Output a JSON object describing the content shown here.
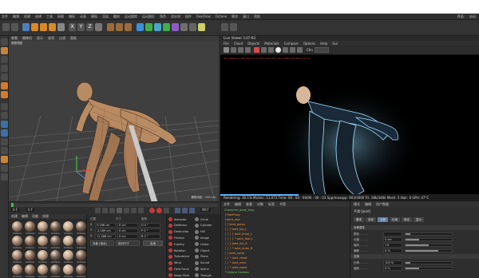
{
  "menubar": {
    "items": [
      "文件",
      "编辑",
      "创建",
      "选择",
      "工具",
      "网格",
      "捕捉",
      "动画",
      "模拟",
      "渲染",
      "雕刻",
      "运动跟踪",
      "运动图形",
      "角色",
      "流水线",
      "插件",
      "RealFlow",
      "Octane",
      "脚本",
      "窗口",
      "帮助"
    ],
    "right_items": [
      "界面:",
      "启动"
    ]
  },
  "viewport": {
    "menu": [
      "查看",
      "摄像机",
      "显示",
      "选项",
      "过滤",
      "面板"
    ],
    "title": "透视视图",
    "footer": "栅格间距 : 100 cm"
  },
  "live_viewer": {
    "title": "Live Viewer 3.07-R2",
    "menu": [
      "File",
      "Cloud",
      "Objects",
      "Materials",
      "Compare",
      "Options",
      "Help",
      "Gui"
    ],
    "channel": "Chn",
    "status": "Rendering: 30.1%   Ms/sec: 11.073   Time: 00 : 00 : 00/00 : 00 : 03   Spp/maxspp: 903/3000   Tri: 18k/346k   Mesh: 5   Hair: 0   GPU: 47°C",
    "progress": 0.301,
    "top_info": "Tone Mapping ON  Gamma 2.2  Denoiser  Film size 1280x720  Path tracing"
  },
  "timeline": {
    "start_frame": "0 F",
    "end_frame": "90 F",
    "current_frame": "0 F"
  },
  "materials": {
    "menu": [
      "创建",
      "编辑",
      "功能",
      "纹理"
    ],
    "items": [
      "Octane",
      "Octane",
      "Octane",
      "Octane",
      "Octane",
      "Octane",
      "Octane",
      "Octane",
      "Octane",
      "Octane",
      "Octane",
      "Octane",
      "Octane",
      "Octane",
      "Octane",
      "Octane",
      "Octane",
      "Octane",
      "Octane",
      "Octane",
      "Octane",
      "Octane",
      "Octane",
      "Octane"
    ]
  },
  "coordinates": {
    "headers": [
      "位置",
      "尺寸",
      "旋转"
    ],
    "rows": [
      {
        "axis": "X",
        "pos": "5.396 cm",
        "size": "0 cm",
        "rot": "H 0 °"
      },
      {
        "axis": "Y",
        "pos": "-4.169 cm",
        "size": "0 cm",
        "rot": "P 0 °"
      },
      {
        "axis": "Z",
        "pos": "11.288 cm",
        "size": "0 cm",
        "rot": "B 0 °"
      }
    ],
    "mode": "对象 (相对)",
    "size_mode": "绝对尺寸",
    "apply": "应用"
  },
  "object_list": {
    "col1": [
      "Attractor",
      "Deflector",
      "Destructor",
      "Friction",
      "Gravity",
      "Rotation",
      "Turbulence",
      "Wind",
      "Field Force",
      "Noise Field"
    ],
    "col2": [
      "Circle",
      "Cylinder",
      "Hill",
      "Image",
      "Linear",
      "Object",
      "Plane",
      "Sound",
      "Spline",
      "Triangle"
    ]
  },
  "hierarchy": {
    "menu": [
      "文件",
      "编辑",
      "查看",
      "对象",
      "标签",
      "书签"
    ],
    "rows": [
      "Character_body_Xray",
      "├ HairProxy",
      "├ Joint_root",
      "│ ├ Joint_pelvis",
      "│ │ ├ Joint_hip_L",
      "│ │ │ ├ Joint_knee_L",
      "│ │ │ │ └ Joint_foot_L",
      "│ │ ├ Joint_hip_R",
      "│ │ │ └ Joint_knee_R",
      "│ ├ Joint_spine",
      "│ │ └ Joint_chest",
      "│ │   └ Joint_neck",
      "│ │     └ Joint_head",
      "└ Octane Camera"
    ]
  },
  "attributes": {
    "menu": [
      "模式",
      "编辑",
      "用户数据"
    ],
    "object_title": "平滑 [Joint]",
    "tabs": [
      "基本",
      "坐标",
      "对象",
      "约束",
      "绑定",
      "显示"
    ],
    "section1": "对象属性",
    "rows": [
      {
        "label": "颜色 . . . . .",
        "value": ""
      },
      {
        "label": "长度 . . . . .",
        "value": "0 cm"
      },
      {
        "label": "轴向 . . . . .",
        "value": "+X"
      },
      {
        "label": "偏移 . . . . .",
        "value": "0 %"
      }
    ],
    "section2": "变换",
    "rows2": [
      {
        "label": "比例 . . . . .",
        "value": "100 %"
      },
      {
        "label": "缩放 . . . . .",
        "value": "0 %"
      }
    ]
  },
  "colors": {
    "accent": "#5f7fa8",
    "progress": "#5ab0ff",
    "hierarchy_orange": "#ff9a3c",
    "hierarchy_green": "#7ad36a"
  }
}
